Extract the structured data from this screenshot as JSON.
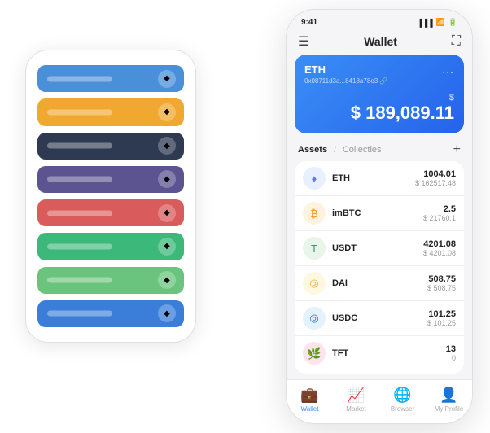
{
  "bg_phone": {
    "cards": [
      {
        "color": "#4a90d9",
        "icon": "◆"
      },
      {
        "color": "#f0a830",
        "icon": "◆"
      },
      {
        "color": "#2d3a52",
        "icon": "◆"
      },
      {
        "color": "#5b5490",
        "icon": "◆"
      },
      {
        "color": "#d95b5b",
        "icon": "◆"
      },
      {
        "color": "#3cb87a",
        "icon": "◆"
      },
      {
        "color": "#6ac47e",
        "icon": "◆"
      },
      {
        "color": "#3a7ed9",
        "icon": "◆"
      }
    ]
  },
  "header": {
    "title": "Wallet",
    "time": "9:41"
  },
  "wallet_card": {
    "name": "ETH",
    "address": "0x08711d3a...8418a78e3",
    "address_suffix": "🔗",
    "balance_currency": "$",
    "balance": "189,089.11",
    "dots": "..."
  },
  "assets": {
    "tab_active": "Assets",
    "tab_divider": "/",
    "tab_inactive": "Collecties",
    "add_icon": "+"
  },
  "asset_list": [
    {
      "name": "ETH",
      "icon_bg": "#e8f0ff",
      "icon_text": "♦",
      "icon_color": "#627EEA",
      "amount": "1004.01",
      "usd": "$ 162517.48"
    },
    {
      "name": "imBTC",
      "icon_bg": "#fff3e0",
      "icon_text": "₿",
      "icon_color": "#F7931A",
      "amount": "2.5",
      "usd": "$ 21760.1"
    },
    {
      "name": "USDT",
      "icon_bg": "#e8f5e9",
      "icon_text": "T",
      "icon_color": "#26A17B",
      "amount": "4201.08",
      "usd": "$ 4201.08"
    },
    {
      "name": "DAI",
      "icon_bg": "#fff8e1",
      "icon_text": "◎",
      "icon_color": "#F5AC37",
      "amount": "508.75",
      "usd": "$ 508.75"
    },
    {
      "name": "USDC",
      "icon_bg": "#e3f2fd",
      "icon_text": "◎",
      "icon_color": "#2775CA",
      "amount": "101.25",
      "usd": "$ 101.25"
    },
    {
      "name": "TFT",
      "icon_bg": "#fce4ec",
      "icon_text": "🌿",
      "icon_color": "#e91e8c",
      "amount": "13",
      "usd": "0"
    }
  ],
  "nav": [
    {
      "label": "Wallet",
      "icon": "💼",
      "active": true
    },
    {
      "label": "Market",
      "icon": "📈",
      "active": false
    },
    {
      "label": "Browser",
      "icon": "🌐",
      "active": false
    },
    {
      "label": "My Profile",
      "icon": "👤",
      "active": false
    }
  ]
}
